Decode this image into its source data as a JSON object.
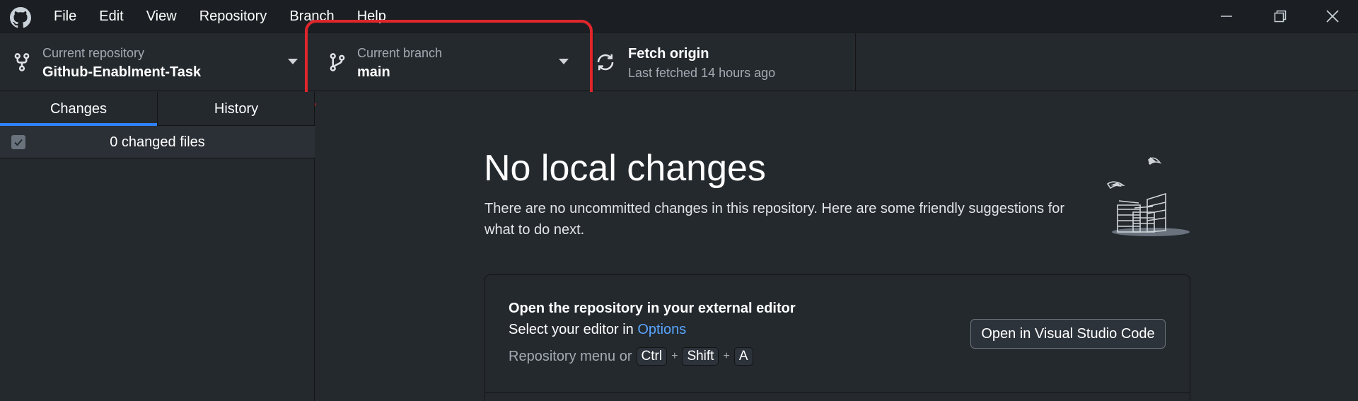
{
  "menu": [
    "File",
    "Edit",
    "View",
    "Repository",
    "Branch",
    "Help"
  ],
  "toolbar": {
    "repository": {
      "label": "Current repository",
      "value": "Github-Enablment-Task"
    },
    "branch": {
      "label": "Current branch",
      "value": "main"
    },
    "fetch": {
      "label": "Fetch origin",
      "value": "Last fetched 14 hours ago"
    }
  },
  "sidebar": {
    "tabs": [
      "Changes",
      "History"
    ],
    "changes_summary": "0 changed files"
  },
  "main": {
    "heading": "No local changes",
    "description": "There are no uncommitted changes in this repository. Here are some friendly suggestions for what to do next.",
    "card": {
      "title": "Open the repository in your external editor",
      "subtitle_prefix": "Select your editor in ",
      "subtitle_link": "Options",
      "hint_prefix": "Repository menu or",
      "keys": [
        "Ctrl",
        "Shift",
        "A"
      ],
      "button": "Open in Visual Studio Code"
    }
  },
  "colors": {
    "accent": "#2f81f7",
    "highlight": "#e0262b",
    "link": "#58a6ff",
    "background": "#24292e"
  }
}
